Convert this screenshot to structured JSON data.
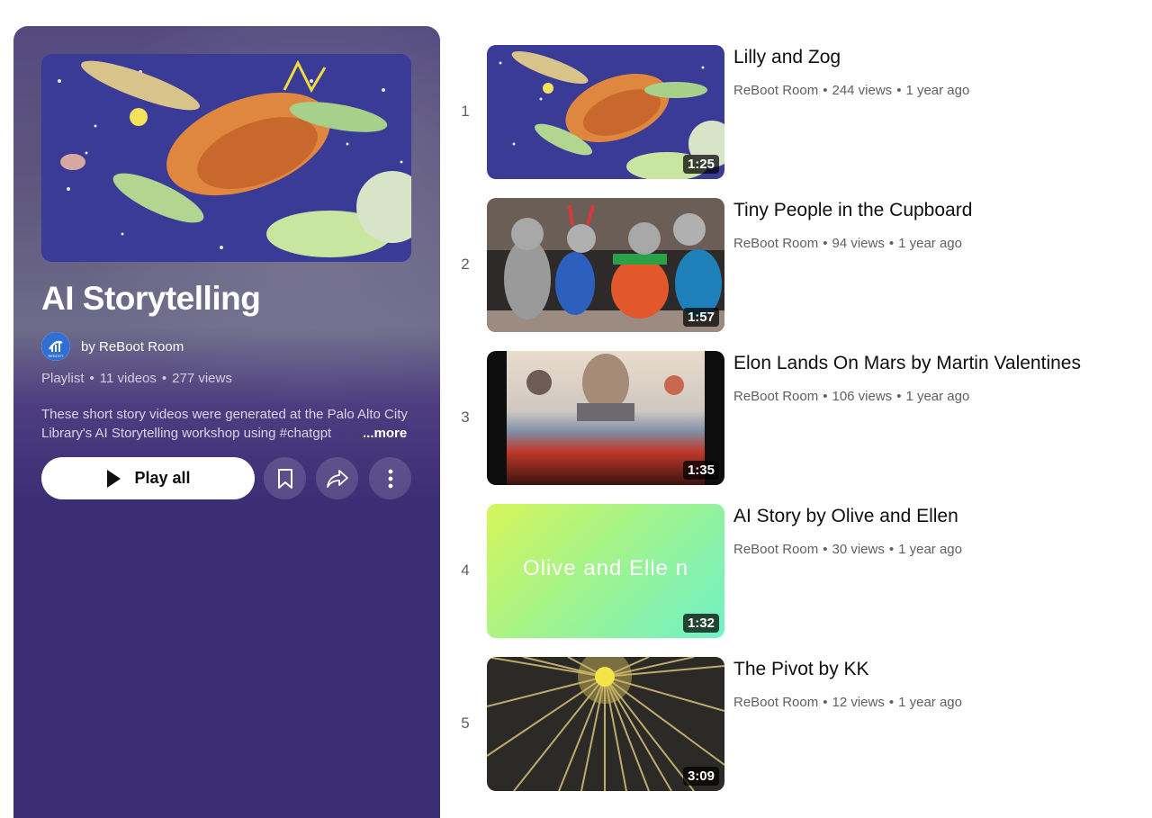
{
  "playlist": {
    "title": "AI Storytelling",
    "owner": "by ReBoot Room",
    "avatar_text": "REBOOT",
    "type": "Playlist",
    "video_count": "11 videos",
    "views": "277 views",
    "separator": "•",
    "description": "These short story videos were generated at the Palo Alto City Library's AI Storytelling workshop using #chatgpt",
    "more_label": "...more",
    "play_all_label": "Play all",
    "icons": [
      "play-icon",
      "bookmark-icon",
      "share-icon",
      "more-vert-icon"
    ]
  },
  "videos": [
    {
      "index": "1",
      "title": "Lilly and Zog",
      "channel": "ReBoot Room",
      "views": "244 views",
      "age": "1 year ago",
      "duration": "1:25"
    },
    {
      "index": "2",
      "title": "Tiny People in the Cupboard",
      "channel": "ReBoot Room",
      "views": "94 views",
      "age": "1 year ago",
      "duration": "1:57"
    },
    {
      "index": "3",
      "title": "Elon Lands On Mars by Martin Valentines",
      "channel": "ReBoot Room",
      "views": "106 views",
      "age": "1 year ago",
      "duration": "1:35"
    },
    {
      "index": "4",
      "title": "AI Story by Olive and Ellen",
      "channel": "ReBoot Room",
      "views": "30 views",
      "age": "1 year ago",
      "duration": "1:32",
      "thumb_text": "Olive and Elle n"
    },
    {
      "index": "5",
      "title": "The Pivot by KK",
      "channel": "ReBoot Room",
      "views": "12 views",
      "age": "1 year ago",
      "duration": "3:09"
    }
  ],
  "colors": {
    "panel_bg": "#3c2e75",
    "text_primary": "#0f0f0f",
    "text_secondary": "#606060"
  }
}
